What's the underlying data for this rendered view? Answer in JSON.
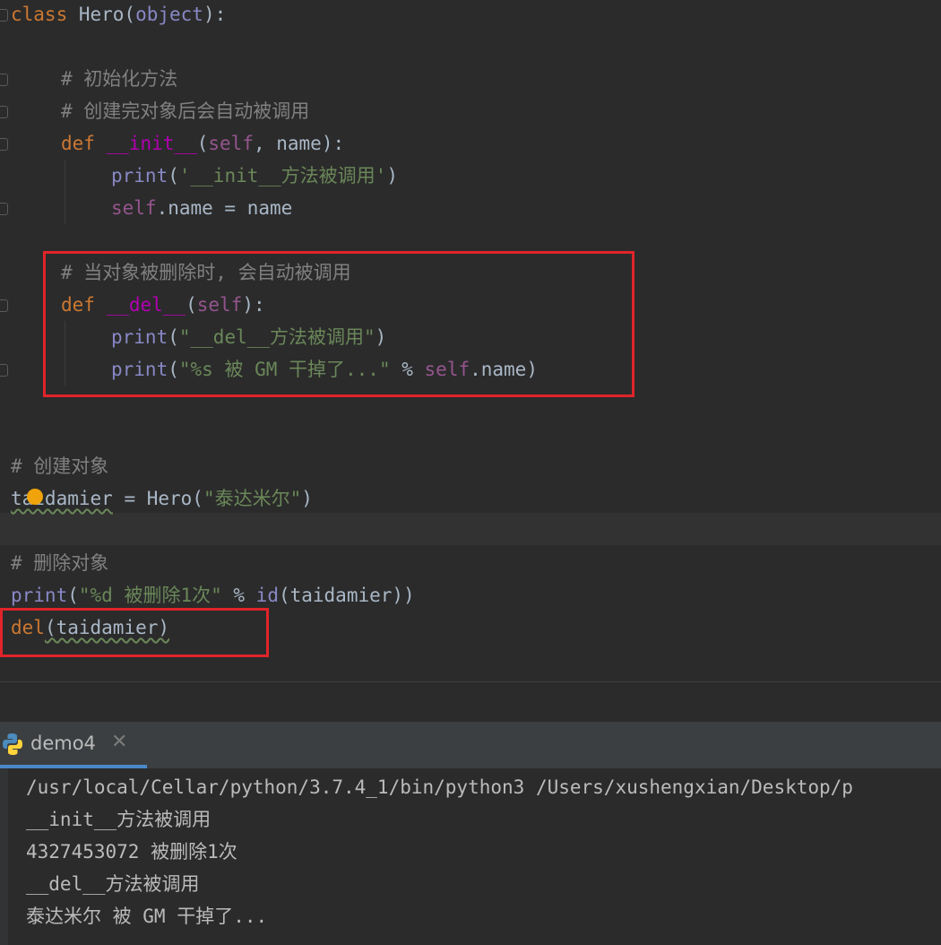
{
  "editor": {
    "lines": {
      "l1_kw": "class",
      "l1_name": " Hero(",
      "l1_obj": "object",
      "l1_end": "):",
      "l3": "# 初始化方法",
      "l4": "# 创建完对象后会自动被调用",
      "l5_kw": "def ",
      "l5_fn": "__init__",
      "l5_open": "(",
      "l5_self": "self",
      "l5_rest": ", name):",
      "l6_print": "print",
      "l6_open": "(",
      "l6_str": "'__init__方法被调用'",
      "l6_close": ")",
      "l7_self": "self",
      "l7_rest": ".name = name",
      "l9": "# 当对象被删除时, 会自动被调用",
      "l10_kw": "def ",
      "l10_fn": "__del__",
      "l10_open": "(",
      "l10_self": "self",
      "l10_rest": "):",
      "l11_print": "print",
      "l11_open": "(",
      "l11_str": "\"__del__方法被调用\"",
      "l11_close": ")",
      "l12_print": "print",
      "l12_open": "(",
      "l12_str": "\"%s 被 GM 干掉了...\"",
      "l12_op": " % ",
      "l12_self": "self",
      "l12_rest": ".name)",
      "l15": "# 创建对象",
      "l16_var": "taidamier",
      "l16_mid": " = Hero(",
      "l16_str": "\"泰达米尔\"",
      "l16_close": ")",
      "l18": "# 删除对象",
      "l19_print": "print",
      "l19_open": "(",
      "l19_str": "\"%d 被删除1次\"",
      "l19_op": " % ",
      "l19_id": "id",
      "l19_rest": "(taidamier))",
      "l20_kw": "del",
      "l20_rest": "(taidamier)"
    }
  },
  "run_panel": {
    "tab_label": "demo4",
    "close_glyph": "✕",
    "output": [
      "/usr/local/Cellar/python/3.7.4_1/bin/python3 /Users/xushengxian/Desktop/p",
      "__init__方法被调用",
      "4327453072 被删除1次",
      "__del__方法被调用",
      "泰达米尔 被 GM 干掉了..."
    ]
  },
  "icons": {
    "tab_icon": "python-icon",
    "gutter_icon": "intention-bulb-icon"
  },
  "colors": {
    "background": "#2b2b2b",
    "keyword": "#cc7832",
    "string": "#6a8759",
    "comment": "#808080",
    "highlight_box": "#e0242a",
    "tab_accent": "#4a88c7"
  }
}
